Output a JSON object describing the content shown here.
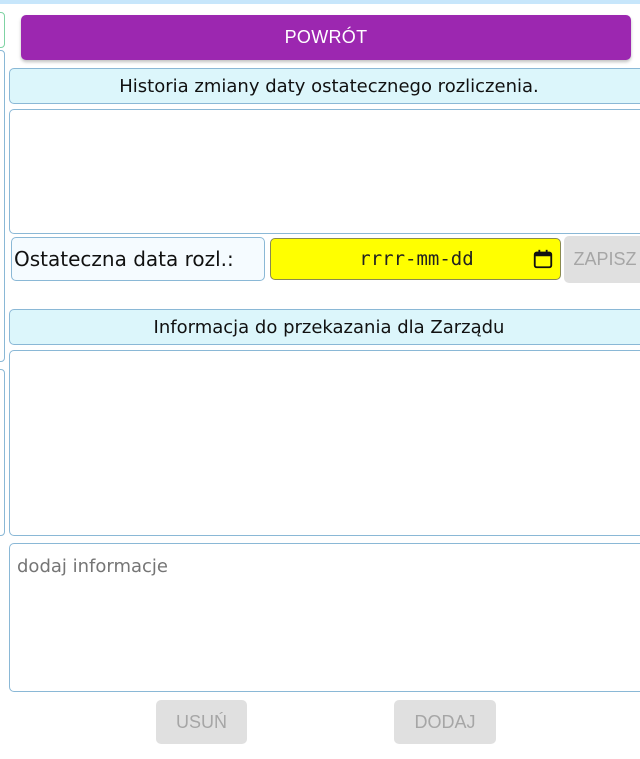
{
  "buttons": {
    "back_label": "POWRÓT",
    "save_label": "ZAPISZ",
    "delete_label": "USUŃ",
    "add_label": "DODAJ"
  },
  "history": {
    "title": "Historia zmiany daty ostatecznego rozliczenia."
  },
  "settlement": {
    "label": "Ostateczna data rozl.:",
    "date_placeholder": "rrrr-mm-dd"
  },
  "board_info": {
    "title": "Informacja do przekazania dla Zarządu",
    "input_placeholder": "dodaj informacje"
  },
  "colors": {
    "accent": "#9c27b0",
    "date_field": "#ffff00",
    "section_header": "#dcf6fb",
    "disabled_button": "#e0e0e0"
  }
}
